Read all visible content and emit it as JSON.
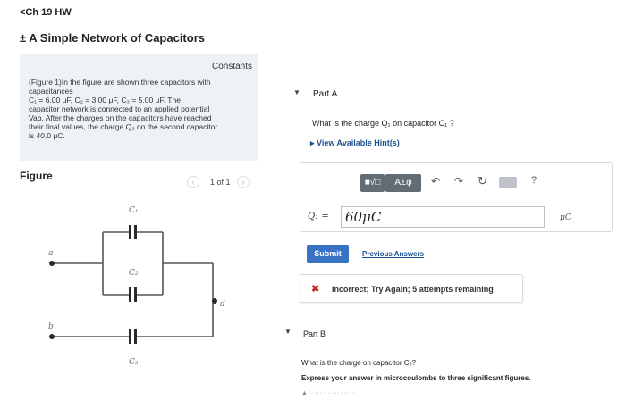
{
  "header": {
    "back_label": "<Ch 19 HW",
    "title": "± A Simple Network of Capacitors"
  },
  "problem": {
    "constants_label": "Constants",
    "lines": [
      "(Figure 1)In the figure are shown three capacitors with",
      "capacitances",
      "C₁ = 6.00 μF, C₂ = 3.00 μF, C₃ = 5.00 μF. The",
      "capacitor network is connected to an applied potential",
      "Vab. After the charges on the capacitors have reached",
      "their final values, the charge Q₂ on the second capacitor",
      "is 40.0 μC."
    ]
  },
  "figure": {
    "label": "Figure",
    "pager_text": "1 of 1",
    "prev_icon": "‹",
    "next_icon": "›",
    "labels": {
      "c1": "C₁",
      "c2": "C₂",
      "c3": "C₃",
      "a": "a",
      "b": "b",
      "d": "d"
    }
  },
  "partA": {
    "caret": "▼",
    "label": "Part A",
    "question": "What is the charge Q₁ on capacitor C₁ ?",
    "hints_label": "▸  View Available Hint(s)",
    "toolbar": {
      "matrix": "■√□",
      "greek": "ΑΣφ",
      "undo": "↶",
      "redo": "↷",
      "reset": "↻",
      "help": "?"
    },
    "answer_lhs": "Q₁ =",
    "answer_value": "60μC",
    "answer_unit": "μC",
    "submit_label": "Submit",
    "previous_answers_label": "Previous Answers",
    "feedback_icon": "✖",
    "feedback_text": "Incorrect; Try Again; 5 attempts remaining"
  },
  "partB": {
    "caret": "▼",
    "label": "Part B",
    "question": "What is the charge on capacitor C₃?",
    "instruction": "Express your answer in microcoulombs to three significant figures.",
    "cut_text": "▲ ····· ·········"
  }
}
